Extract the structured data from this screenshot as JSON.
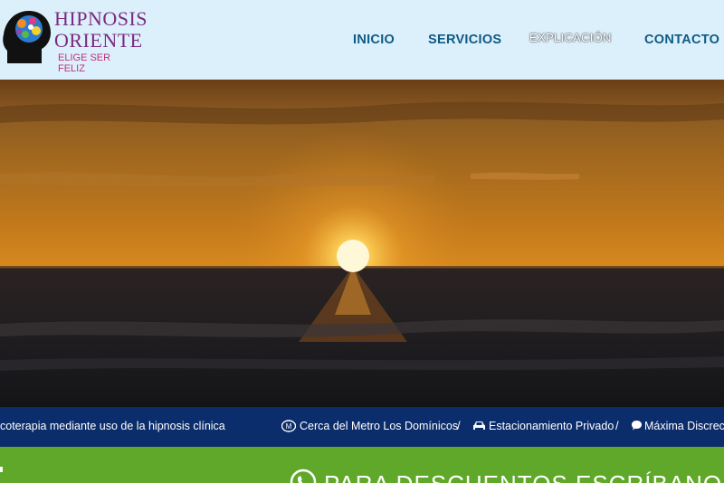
{
  "brand": {
    "line1": "HIPNOSIS",
    "line2": "ORIENTE",
    "tagline": "ELIGE SER FELIZ"
  },
  "nav": {
    "items": [
      {
        "label": "INICIO"
      },
      {
        "label": "SERVICIOS"
      },
      {
        "label": "EXPLICACIÓN"
      },
      {
        "label": "CONTACTO"
      }
    ]
  },
  "strip": {
    "item1": "coterapia mediante uso de la hipnosis clínica",
    "item2": "Cerca del Metro Los Domínicos",
    "item3": "Estacionamiento Privado",
    "item4": "Máxima Discrecio",
    "separator": "/"
  },
  "promo": {
    "text": "PARA DESCUENTOS ESCRÍBANOS PO"
  },
  "colors": {
    "header_bg": "#dcf0fb",
    "nav": "#0f5a84",
    "brand": "#7a2a82",
    "strip_bg": "#0c2d6b",
    "promo_bg": "#5fa829"
  }
}
